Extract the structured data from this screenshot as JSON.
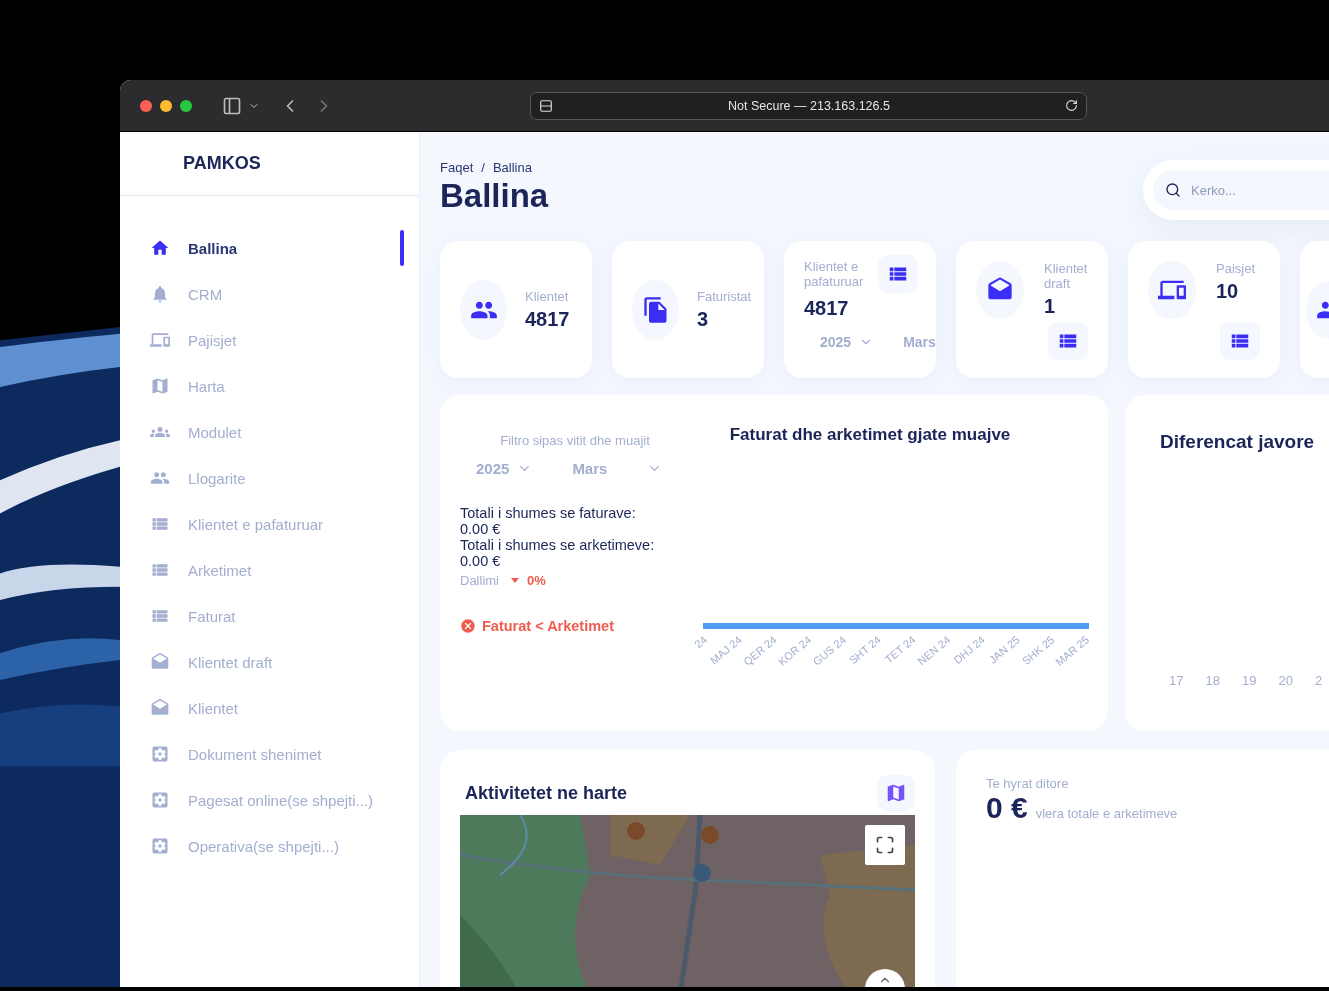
{
  "browser": {
    "address": "Not Secure — 213.163.126.5"
  },
  "sidebar": {
    "logo": "PAMKOS",
    "items": [
      {
        "label": "Ballina",
        "selected": true
      },
      {
        "label": "CRM",
        "selected": false
      },
      {
        "label": "Pajisjet",
        "selected": false
      },
      {
        "label": "Harta",
        "selected": false
      },
      {
        "label": "Modulet",
        "selected": false
      },
      {
        "label": "Llogarite",
        "selected": false
      },
      {
        "label": "Klientet e pafaturuar",
        "selected": false
      },
      {
        "label": "Arketimet",
        "selected": false
      },
      {
        "label": "Faturat",
        "selected": false
      },
      {
        "label": "Klientet draft",
        "selected": false
      },
      {
        "label": "Klientet",
        "selected": false
      },
      {
        "label": "Dokument shenimet",
        "selected": false
      },
      {
        "label": "Pagesat online(se shpejti...)",
        "selected": false
      },
      {
        "label": "Operativa(se shpejti...)",
        "selected": false
      }
    ]
  },
  "header": {
    "breadcrumb": [
      "Faqet",
      "Ballina"
    ],
    "separator": "/",
    "title": "Ballina",
    "search": {
      "placeholder": "Kerko..."
    }
  },
  "stat_cards": [
    {
      "kind": "icon",
      "label": "Klientet",
      "value": "4817"
    },
    {
      "kind": "icon",
      "label": "Faturistat",
      "value": "3"
    },
    {
      "kind": "filter",
      "label": "Klientet e pafaturuar",
      "value": "4817",
      "year": "2025",
      "month": "Mars"
    },
    {
      "kind": "action",
      "label": "Klientet draft",
      "value": "1"
    },
    {
      "kind": "action",
      "label": "Paisjet",
      "value": "10"
    },
    {
      "kind": "cut"
    }
  ],
  "monthly_card": {
    "filter_label": "Filtro sipas vitit dhe muajit",
    "year": "2025",
    "month": "Mars",
    "totals": [
      "Totali i shumes se faturave: 0.00 €",
      "Totali i shumes se arketimeve: 0.00 €"
    ],
    "difference_label": "Dallimi",
    "difference": "0%",
    "status": "Faturat < Arketimet",
    "chart_title": "Faturat dhe arketimet gjate muajve",
    "x_labels": [
      "24",
      "MAJ 24",
      "QER 24",
      "KOR 24",
      "GUS 24",
      "SHT 24",
      "TET 24",
      "NEN 24",
      "DHJ 24",
      "JAN 25",
      "SHK 25",
      "MAR 25"
    ]
  },
  "weekly_card": {
    "title": "Diferencat javore",
    "x_labels": [
      "17",
      "18",
      "19",
      "20",
      "2"
    ]
  },
  "map_card": {
    "title": "Aktivitetet ne harte"
  },
  "daily_card": {
    "label": "Te hyrat ditore",
    "amount": "0 €",
    "caption": "vlera totale e arketimeve"
  }
}
